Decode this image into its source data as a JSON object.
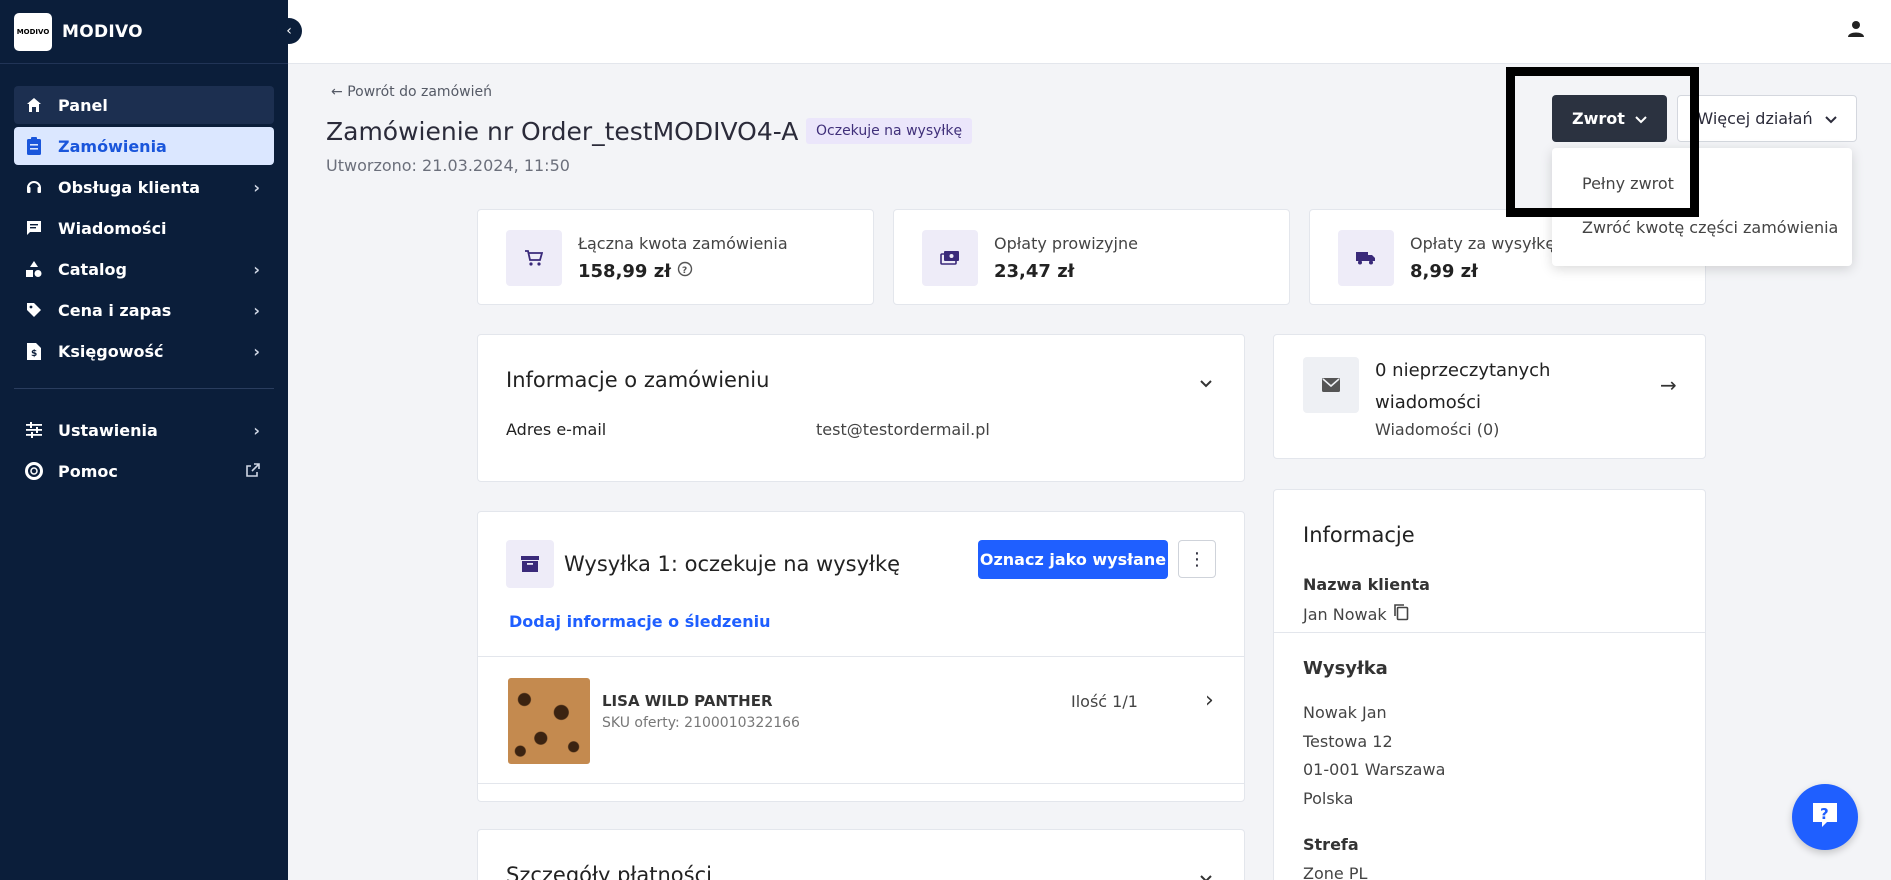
{
  "brand": {
    "logo_text": "MODIVO",
    "name": "MODIVO"
  },
  "sidebar": {
    "items": [
      {
        "label": "Panel",
        "icon": "home-icon"
      },
      {
        "label": "Zamówienia",
        "icon": "clipboard-icon"
      },
      {
        "label": "Obsługa klienta",
        "icon": "headset-icon"
      },
      {
        "label": "Wiadomości",
        "icon": "chat-icon"
      },
      {
        "label": "Catalog",
        "icon": "shapes-icon"
      },
      {
        "label": "Cena i zapas",
        "icon": "tag-icon"
      },
      {
        "label": "Księgowość",
        "icon": "invoice-icon"
      },
      {
        "label": "Ustawienia",
        "icon": "sliders-icon"
      },
      {
        "label": "Pomoc",
        "icon": "lifebuoy-icon"
      }
    ]
  },
  "header": {
    "back_label": "Powrót do zamówień",
    "title": "Zamówienie nr Order_testMODIVO4-A",
    "status": "Oczekuje na wysyłkę",
    "created": "Utworzono: 21.03.2024, 11:50",
    "refund_button": "Zwrot",
    "more_button": "Więcej działań"
  },
  "refund_menu": {
    "options": [
      "Pełny zwrot",
      "Zwróć kwotę części zamówienia"
    ]
  },
  "stats": [
    {
      "label": "Łączna kwota zamówienia",
      "value": "158,99 zł",
      "icon": "cart-icon"
    },
    {
      "label": "Opłaty prowizyjne",
      "value": "23,47 zł",
      "icon": "money-icon"
    },
    {
      "label": "Opłaty za wysyłkę",
      "value": "8,99 zł",
      "icon": "truck-icon"
    }
  ],
  "order_info": {
    "title": "Informacje o zamówieniu",
    "email_label": "Adres e-mail",
    "email_value": "test@testordermail.pl"
  },
  "messages": {
    "title": "0 nieprzeczytanych wiadomości",
    "subtitle": "Wiadomości (0)"
  },
  "shipment": {
    "title": "Wysyłka 1: oczekuje na wysyłkę",
    "mark_sent_button": "Oznacz jako wysłane",
    "tracking_link": "Dodaj informacje o śledzeniu",
    "item": {
      "name": "LISA WILD PANTHER",
      "sku": "SKU oferty: 2100010322166",
      "quantity": "Ilość 1/1"
    }
  },
  "payment": {
    "title": "Szczegóły płatności"
  },
  "info_panel": {
    "title": "Informacje",
    "customer_label": "Nazwa klienta",
    "customer_value": "Jan Nowak",
    "shipping_label": "Wysyłka",
    "address_lines": [
      "Nowak Jan",
      "Testowa 12",
      "01-001 Warszawa",
      "Polska"
    ],
    "zone_label": "Strefa",
    "zone_value": "Zone PL"
  }
}
